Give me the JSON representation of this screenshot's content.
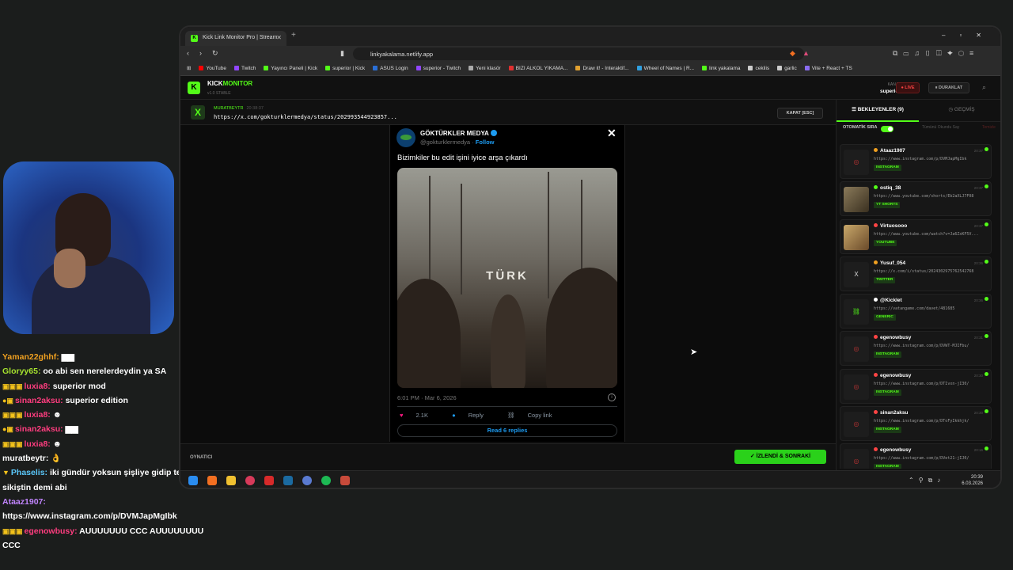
{
  "colors": {
    "kick_green": "#53fc18",
    "live_red": "#ff4444",
    "twitter_blue": "#1d9bf0"
  },
  "stream_chat": [
    {
      "user": "Yaman22ghhf:",
      "user_color": "#f0a020",
      "msg": "▆▆",
      "badges": ""
    },
    {
      "user": "Gloryy65:",
      "user_color": "#a6e22e",
      "msg": "oo abi sen nerelerdeydin ya SA",
      "badges": ""
    },
    {
      "user": "luxia8:",
      "user_color": "#ff3d7f",
      "msg": "superior mod",
      "badges": "▣▣▣"
    },
    {
      "user": "sinan2aksu:",
      "user_color": "#ff3d7f",
      "msg": "superior edition",
      "badges": "●▣"
    },
    {
      "user": "luxia8:",
      "user_color": "#ff3d7f",
      "msg": "☻",
      "badges": "▣▣▣"
    },
    {
      "user": "sinan2aksu:",
      "user_color": "#ff3d7f",
      "msg": "▆▆",
      "badges": "●▣"
    },
    {
      "user": "luxia8:",
      "user_color": "#ff3d7f",
      "msg": "☻",
      "badges": "▣▣▣"
    },
    {
      "user": "muratbeytr:",
      "user_color": "#ffffff",
      "msg": "👌",
      "badges": ""
    },
    {
      "user": "Phaselis:",
      "user_color": "#5ac8fa",
      "msg": "iki gündür yoksun şişliye gidip terli sikiştin demi abi",
      "badges": "▼"
    },
    {
      "user": "Ataaz1907:",
      "user_color": "#c084fc",
      "msg": "https://www.instagram.com/p/DVMJapMgIbk",
      "badges": ""
    },
    {
      "user": "egenowbusy:",
      "user_color": "#ff3d7f",
      "msg": "AUUUUUUU CCC AUUUUUUUU CCC",
      "badges": "▣▣▣"
    }
  ],
  "browser": {
    "tab_title": "Kick Link Monitor Pro | Stream",
    "url": "linkyakalama.netlify.app",
    "bookmarks": [
      {
        "label": "YouTube",
        "color": "#ff0000"
      },
      {
        "label": "Twitch",
        "color": "#9146ff"
      },
      {
        "label": "Yayıncı Paneli | Kick",
        "color": "#53fc18"
      },
      {
        "label": "superior | Kick",
        "color": "#53fc18"
      },
      {
        "label": "ASUS Login",
        "color": "#2a6fd6"
      },
      {
        "label": "superior - Twitch",
        "color": "#9146ff"
      },
      {
        "label": "Yeni klasör",
        "color": "#aaaaaa"
      },
      {
        "label": "BIZI ALKOL YIKAMA...",
        "color": "#e03030"
      },
      {
        "label": "Draw it! - Interaktif...",
        "color": "#e0a030"
      },
      {
        "label": "Wheel of Names | R...",
        "color": "#30a0e0"
      },
      {
        "label": "link yakalama",
        "color": "#53fc18"
      },
      {
        "label": "cekilis",
        "color": "#cccccc"
      },
      {
        "label": "garlic",
        "color": "#cccccc"
      },
      {
        "label": "Vite + React + TS",
        "color": "#8a6cf0"
      }
    ]
  },
  "app": {
    "logo_letter": "K",
    "brand_a": "KICK",
    "brand_b": "MONITOR",
    "version": "v1.0 STABLE",
    "kanal_label": "KANAL",
    "channel": "superior",
    "live_label": "● LIVE",
    "pause_label": "⏸ DURAKLAT",
    "current": {
      "badge": "X",
      "sender": "MURATBEYTR",
      "time": "20:38:37",
      "url": "https://x.com/gokturklermedya/status/202993544923857...",
      "close_label": "KAPAT [ESC]"
    },
    "tweet": {
      "name": "GÖKTÜRKLER MEDYA",
      "handle": "@gokturklermedya",
      "follow": "Follow",
      "text": "Bizimkiler bu edit işini iyice arşa çıkardı",
      "overlay": "TÜRK",
      "date": "6:01 PM · Mar 6, 2026",
      "likes": "2.1K",
      "reply": "Reply",
      "copy": "Copy link",
      "read_replies": "Read 6 replies"
    },
    "footer_label": "OYNATICI",
    "watched_label": "✓ İZLENDİ & SONRAKİ",
    "sidebar": {
      "tab_waiting": "☰  BEKLEYENLER (9)",
      "tab_history": "◷  GEÇMİŞ",
      "auto_label": "OTOMATİK SIRA",
      "mark_all": "Tümünü Okundu Say",
      "clear_all": "Temizle",
      "queue": [
        {
          "user": "Ataaz1907",
          "dot": "#f0a020",
          "time": "20:37",
          "url": "https://www.instagram.com/p/DVMJapMgIbk",
          "tag": "INSTAGRAM",
          "thumb": "◎"
        },
        {
          "user": "ostiq_38",
          "dot": "#53fc18",
          "time": "20:37",
          "url": "https://www.youtube.com/shorts/Eb2aXLJ7F08",
          "tag": "YT SHORTS",
          "thumb": ""
        },
        {
          "user": "Virtuosooo",
          "dot": "#ff4444",
          "time": "20:37",
          "url": "https://www.youtube.com/watch?v=Ja6ZxKF5V...",
          "tag": "YOUTUBE",
          "thumb": ""
        },
        {
          "user": "Yusuf_054",
          "dot": "#f0a020",
          "time": "20:36",
          "url": "https://x.com/i/status/2024302975762542768",
          "tag": "TWITTER",
          "thumb": "X"
        },
        {
          "user": "@Kicklet",
          "dot": "#ffffff",
          "time": "20:36",
          "url": "https://vatangame.com/davet/481685",
          "tag": "GENERIC",
          "thumb": "⛓"
        },
        {
          "user": "egenowbusy",
          "dot": "#ff4444",
          "time": "20:31",
          "url": "https://www.instagram.com/p/DVWT-MJIFbu/",
          "tag": "INSTAGRAM",
          "thumb": "◎"
        },
        {
          "user": "egenowbusy",
          "dot": "#ff4444",
          "time": "20:30",
          "url": "https://www.instagram.com/p/DTIvxn-jI30/",
          "tag": "INSTAGRAM",
          "thumb": "◎"
        },
        {
          "user": "sinan2aksu",
          "dot": "#ff4444",
          "time": "20:30",
          "url": "https://www.instagram.com/p/DToFyIkkhjk/",
          "tag": "INSTAGRAM",
          "thumb": "◎"
        },
        {
          "user": "egenowbusy",
          "dot": "#ff4444",
          "time": "20:16",
          "url": "https://www.instagram.com/p/DVet21-jIJ0/",
          "tag": "INSTAGRAM",
          "thumb": "◎"
        }
      ]
    }
  },
  "taskbar": {
    "time": "20:39",
    "date": "6.03.2026"
  }
}
